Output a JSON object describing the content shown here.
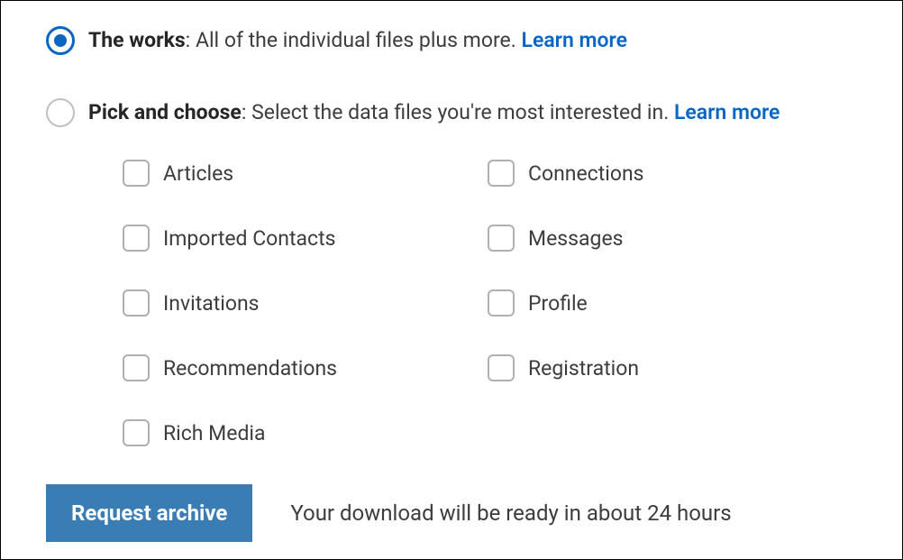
{
  "options": {
    "works": {
      "title": "The works",
      "desc": ": All of the individual files plus more. ",
      "learn_more": "Learn more"
    },
    "pick": {
      "title": "Pick and choose",
      "desc": ": Select the data files you're most interested in. ",
      "learn_more": "Learn more"
    }
  },
  "checkboxes": {
    "articles": "Articles",
    "connections": "Connections",
    "imported_contacts": "Imported Contacts",
    "messages": "Messages",
    "invitations": "Invitations",
    "profile": "Profile",
    "recommendations": "Recommendations",
    "registration": "Registration",
    "rich_media": "Rich Media"
  },
  "footer": {
    "button": "Request archive",
    "hint": "Your download will be ready in about 24 hours"
  }
}
